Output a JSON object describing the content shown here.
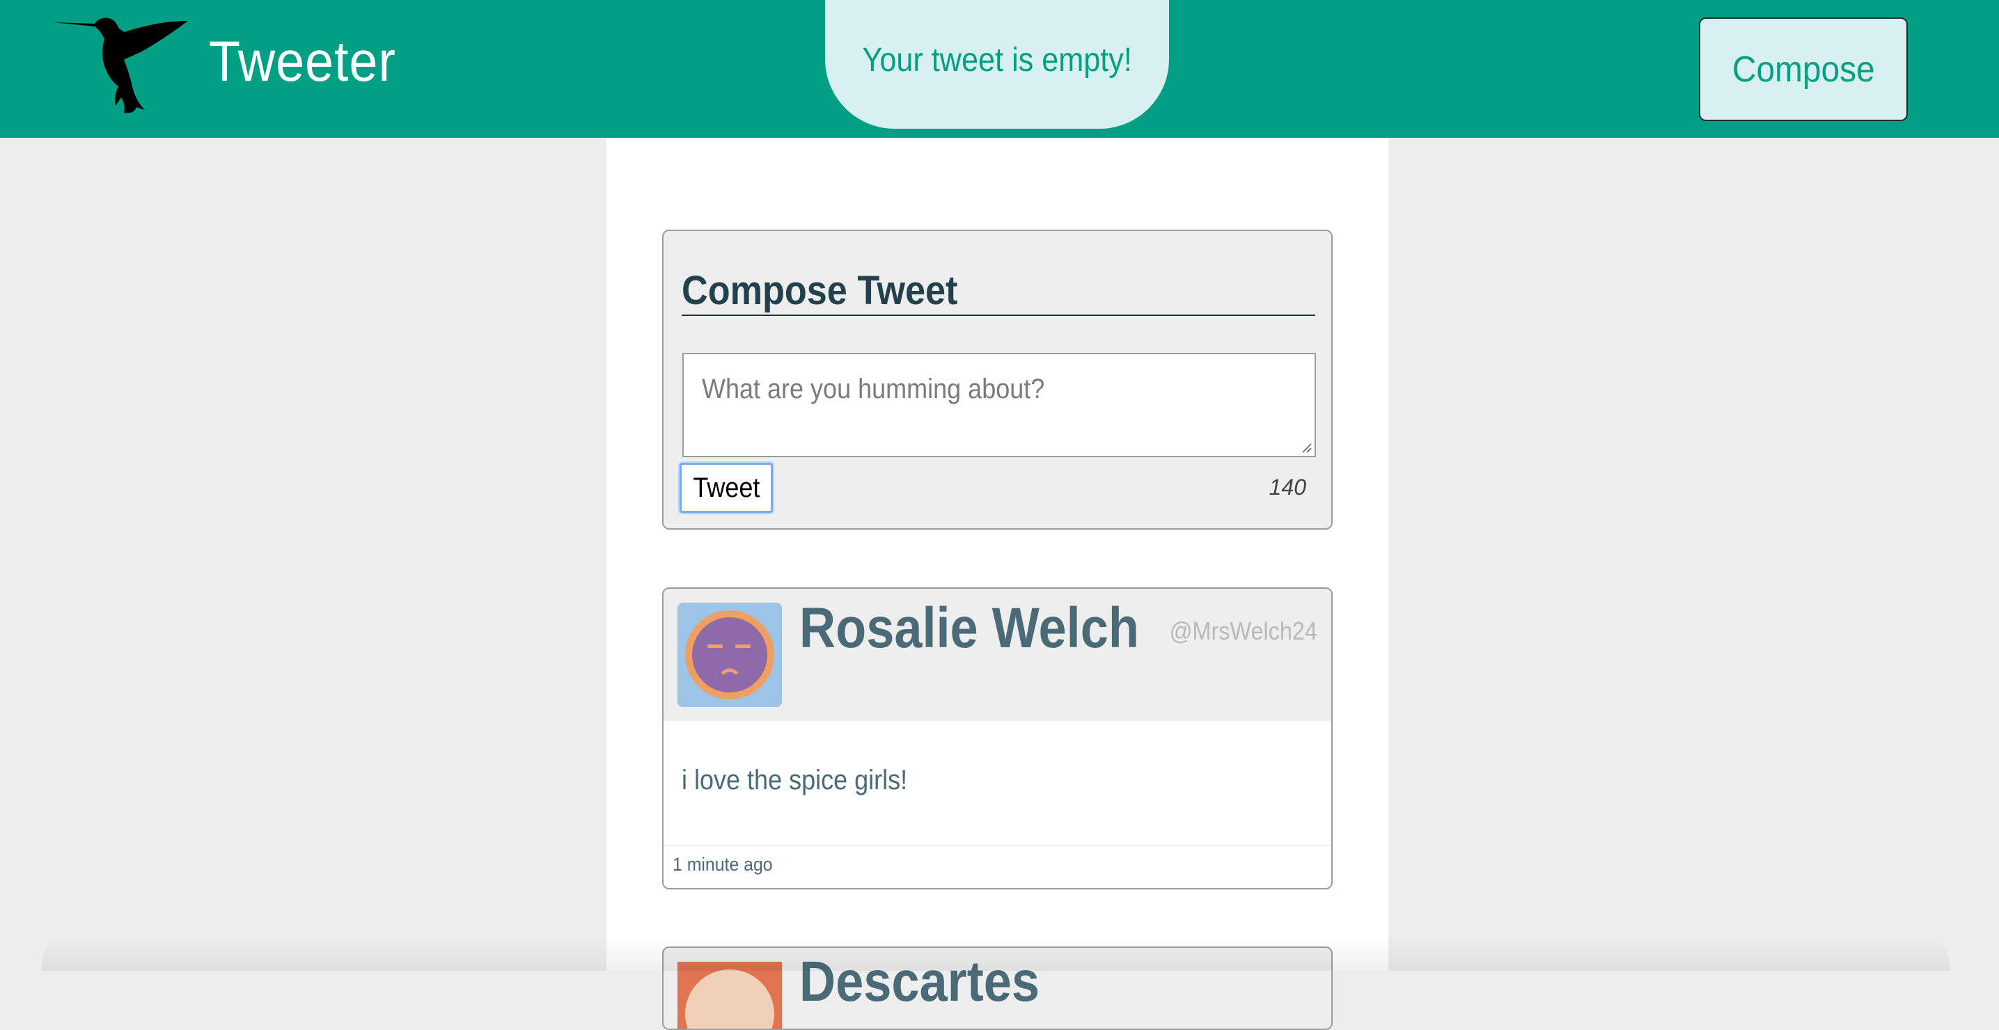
{
  "header": {
    "app_title": "Tweeter",
    "logo_icon": "hummingbird-icon",
    "flash_message": "Your tweet is empty!",
    "compose_label": "Compose"
  },
  "compose": {
    "heading": "Compose Tweet",
    "textarea_placeholder": "What are you humming about?",
    "textarea_value": "",
    "tweet_button_label": "Tweet",
    "char_counter": "140"
  },
  "tweets": [
    {
      "name": "Rosalie Welch",
      "handle": "@MrsWelch24",
      "text": "i love the spice girls!",
      "time": "1 minute ago",
      "avatar_icon": "face-avatar-icon"
    },
    {
      "name": "Descartes",
      "handle": "",
      "text": "",
      "time": "",
      "avatar_icon": "face-avatar-icon"
    }
  ],
  "colors": {
    "brand": "#01a085",
    "flash_bg": "#d8f0ef",
    "text_primary": "#4b6a78",
    "heading": "#23414d",
    "page_bg": "#ededed"
  }
}
